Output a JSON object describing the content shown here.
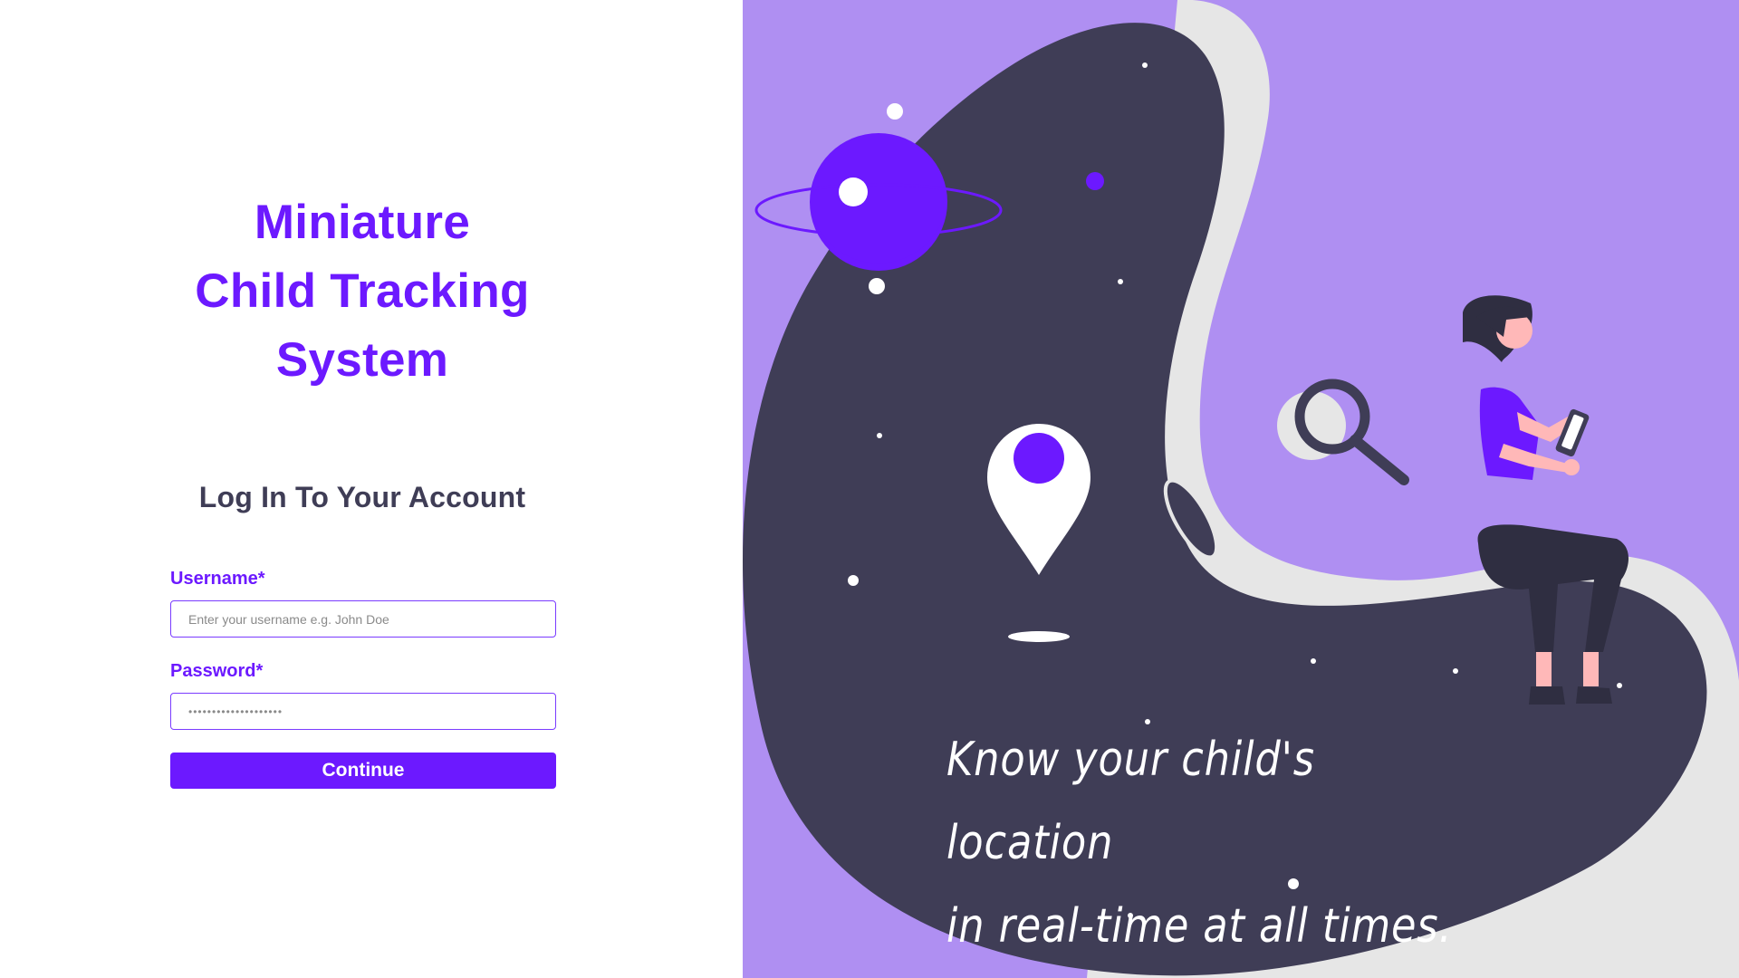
{
  "app": {
    "title_lines": [
      "Miniature",
      "Child Tracking",
      "System"
    ]
  },
  "login": {
    "heading": "Log In To Your Account",
    "username_label": "Username*",
    "username_placeholder": "Enter your username e.g. John Doe",
    "password_label": "Password*",
    "password_value": "••••••••••••••••••••",
    "continue_label": "Continue"
  },
  "hero": {
    "tagline_lines": [
      "Know your child's location",
      "in real-time at all times."
    ]
  },
  "colors": {
    "accent": "#6c19ff",
    "hero_background": "#af8ff2",
    "blob_dark": "#3f3d56",
    "blob_light": "#e6e6e6",
    "heading_text": "#3f3d56"
  },
  "icons": {
    "planet": "planet-icon",
    "location_pin": "map-pin-icon",
    "magnifier": "magnifying-glass-icon",
    "person": "person-with-phone-illustration"
  }
}
